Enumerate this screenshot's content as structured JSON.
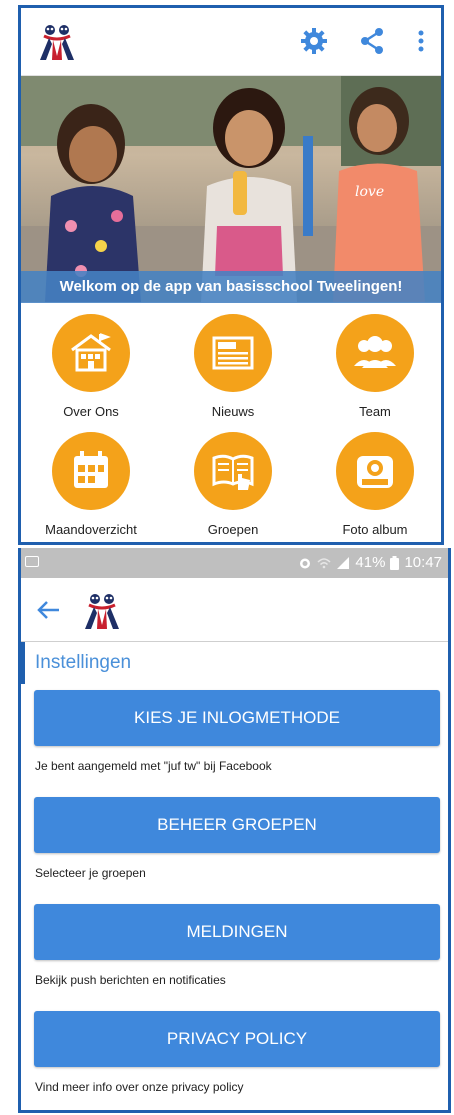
{
  "screen_main": {
    "welcome_text": "Welkom op de app van basisschool Tweelingen!",
    "tiles": [
      {
        "label": "Over Ons",
        "icon": "school-house-icon"
      },
      {
        "label": "Nieuws",
        "icon": "newspaper-icon"
      },
      {
        "label": "Team",
        "icon": "team-people-icon"
      },
      {
        "label": "Maandoverzicht",
        "icon": "calendar-icon"
      },
      {
        "label": "Groepen",
        "icon": "book-hand-icon"
      },
      {
        "label": "Foto album",
        "icon": "camera-icon"
      }
    ],
    "hero_photo_text": "love"
  },
  "screen_settings": {
    "status": {
      "battery": "41%",
      "time": "10:47"
    },
    "title": "Instellingen",
    "items": [
      {
        "button": "KIES JE INLOGMETHODE",
        "hint": "Je bent aangemeld met \"juf tw\" bij Facebook"
      },
      {
        "button": "BEHEER GROEPEN",
        "hint": "Selecteer je groepen"
      },
      {
        "button": "MELDINGEN",
        "hint": "Bekijk push berichten en notificaties"
      },
      {
        "button": "PRIVACY POLICY",
        "hint": "Vind meer info over onze privacy policy"
      }
    ]
  },
  "colors": {
    "accent_orange": "#f4a21a",
    "button_blue": "#3f88dc",
    "title_blue": "#4a90d9",
    "frame_blue": "#1f5fae"
  }
}
